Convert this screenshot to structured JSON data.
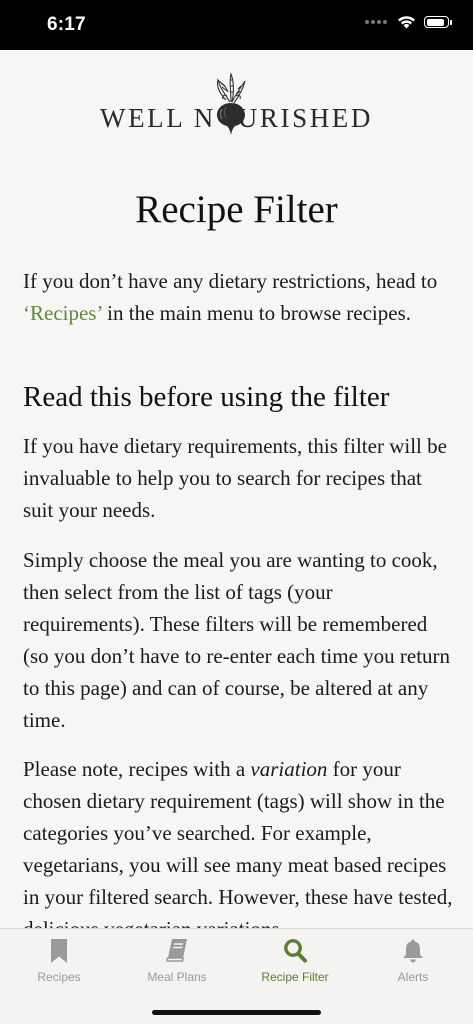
{
  "status_bar": {
    "time": "6:17",
    "battery_level": 0.9,
    "icons": [
      "cellular-dots-icon",
      "wifi-icon",
      "battery-icon"
    ]
  },
  "logo": {
    "text_left": "WELL N",
    "text_right": "URISHED",
    "icon": "beetroot-icon"
  },
  "page": {
    "title": "Recipe Filter",
    "intro_before": "If you don’t have any dietary restrictions, head to ",
    "intro_link": "‘Recipes’",
    "intro_after": " in the main menu to browse recipes.",
    "section_heading": "Read this before using the filter",
    "paragraph_1": "If you have dietary requirements, this filter will be invaluable to help you to search for recipes that suit your needs.",
    "paragraph_2": "Simply choose the meal you are wanting to cook, then select from the list of tags (your requirements). These filters will be remembered (so you don’t have to re-enter each time you return to this page) and can of course, be altered at any time.",
    "paragraph_3_before": "Please note, recipes with a ",
    "paragraph_3_em": "variation",
    "paragraph_3_after": " for your chosen dietary requirement (tags) will show in the categories you’ve searched. For example, vegetarians, you will see many meat based recipes in your filtered search. However, these have tested, delicious vegetarian variations."
  },
  "tab_bar": {
    "active_color": "#5b7e34",
    "inactive_color": "#9a9a9a",
    "tabs": [
      {
        "label": "Recipes",
        "icon": "bookmark-icon",
        "active": false
      },
      {
        "label": "Meal Plans",
        "icon": "book-icon",
        "active": false
      },
      {
        "label": "Recipe Filter",
        "icon": "search-icon",
        "active": true
      },
      {
        "label": "Alerts",
        "icon": "bell-icon",
        "active": false
      }
    ]
  }
}
